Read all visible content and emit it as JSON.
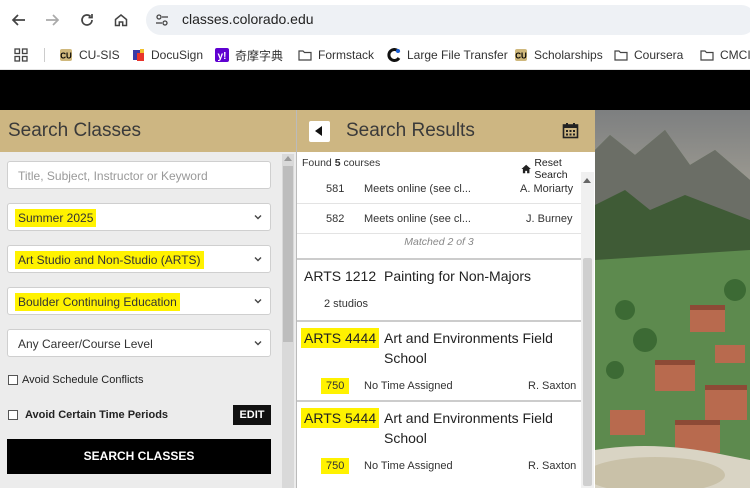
{
  "browser": {
    "url": "classes.colorado.edu",
    "bookmarks": [
      {
        "label": "CU-SIS",
        "icon": "cu-logo-icon"
      },
      {
        "label": "DocuSign",
        "icon": "docusign-icon"
      },
      {
        "label": "奇摩字典",
        "icon": "yahoo-icon"
      },
      {
        "label": "Formstack",
        "icon": "folder-icon"
      },
      {
        "label": "Large File Transfer",
        "icon": "globus-icon"
      },
      {
        "label": "Scholarships",
        "icon": "cu-logo-icon"
      },
      {
        "label": "Coursera",
        "icon": "folder-icon"
      },
      {
        "label": "CMCI",
        "icon": "folder-icon"
      }
    ]
  },
  "search_panel": {
    "title": "Search Classes",
    "keyword_placeholder": "Title, Subject, Instructor or Keyword",
    "term": "Summer 2025",
    "subject": "Art Studio and Non-Studio (ARTS)",
    "campus": "Boulder Continuing Education",
    "career": "Any Career/Course Level",
    "avoid_conflicts_label": "Avoid Schedule Conflicts",
    "avoid_periods_label": "Avoid Certain Time Periods",
    "edit_label": "EDIT",
    "search_label": "SEARCH CLASSES"
  },
  "results_panel": {
    "title": "Search Results",
    "found_prefix": "Found",
    "found_count": "5",
    "found_suffix": "courses",
    "reset_label": "Reset Search",
    "sections": [
      {
        "number": "581",
        "meeting": "Meets online (see cl...",
        "instructor": "A. Moriarty"
      },
      {
        "number": "582",
        "meeting": "Meets online (see cl...",
        "instructor": "J. Burney"
      }
    ],
    "matched_text": "Matched 2 of 3",
    "courses": [
      {
        "code": "ARTS 1212",
        "title": "Painting for Non-Majors",
        "studios": "2 studios"
      },
      {
        "code": "ARTS 4444",
        "title": "Art and Environments Field School",
        "section": "750",
        "meeting": "No Time Assigned",
        "instructor": "R. Saxton"
      },
      {
        "code": "ARTS 5444",
        "title": "Art and Environments Field School",
        "section": "750",
        "meeting": "No Time Assigned",
        "instructor": "R. Saxton"
      }
    ]
  },
  "colors": {
    "header_gold": "#cdb682",
    "highlight": "#fff200",
    "search_button": "#000000"
  }
}
